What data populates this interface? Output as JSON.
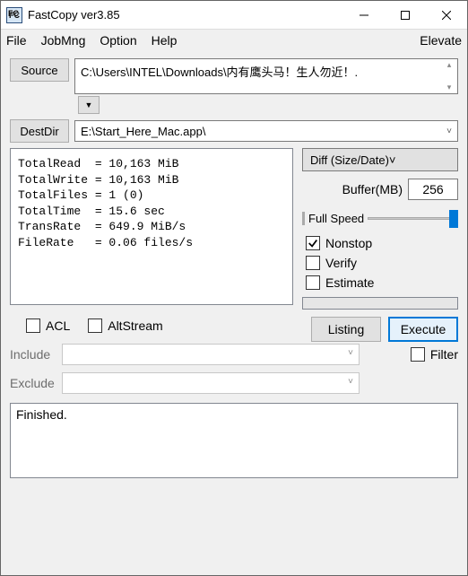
{
  "window": {
    "title": "FastCopy ver3.85",
    "icon_label": "FC"
  },
  "win_buttons": {
    "minimize": "minimize",
    "maximize": "maximize",
    "close": "close"
  },
  "menu": {
    "file": "File",
    "jobmng": "JobMng",
    "option": "Option",
    "help": "Help",
    "elevate": "Elevate"
  },
  "source": {
    "button": "Source",
    "path": "C:\\Users\\INTEL\\Downloads\\内有鹰头马！生人勿近！."
  },
  "dest": {
    "button": "DestDir",
    "path": "E:\\Start_Here_Mac.app\\"
  },
  "stats_text": "TotalRead  = 10,163 MiB\nTotalWrite = 10,163 MiB\nTotalFiles = 1 (0)\nTotalTime  = 15.6 sec\nTransRate  = 649.9 MiB/s\nFileRate   = 0.06 files/s",
  "mode": {
    "selected": "Diff (Size/Date)"
  },
  "buffer": {
    "label": "Buffer(MB)",
    "value": "256"
  },
  "speed": {
    "label": "Full Speed"
  },
  "options": {
    "nonstop": {
      "label": "Nonstop",
      "checked": true
    },
    "verify": {
      "label": "Verify",
      "checked": false
    },
    "estimate": {
      "label": "Estimate",
      "checked": false
    }
  },
  "actions": {
    "listing": "Listing",
    "execute": "Execute"
  },
  "lower_options": {
    "acl": "ACL",
    "altstream": "AltStream",
    "filter": "Filter"
  },
  "filters": {
    "include_label": "Include",
    "exclude_label": "Exclude",
    "include_value": "",
    "exclude_value": ""
  },
  "log": {
    "text": "Finished."
  }
}
